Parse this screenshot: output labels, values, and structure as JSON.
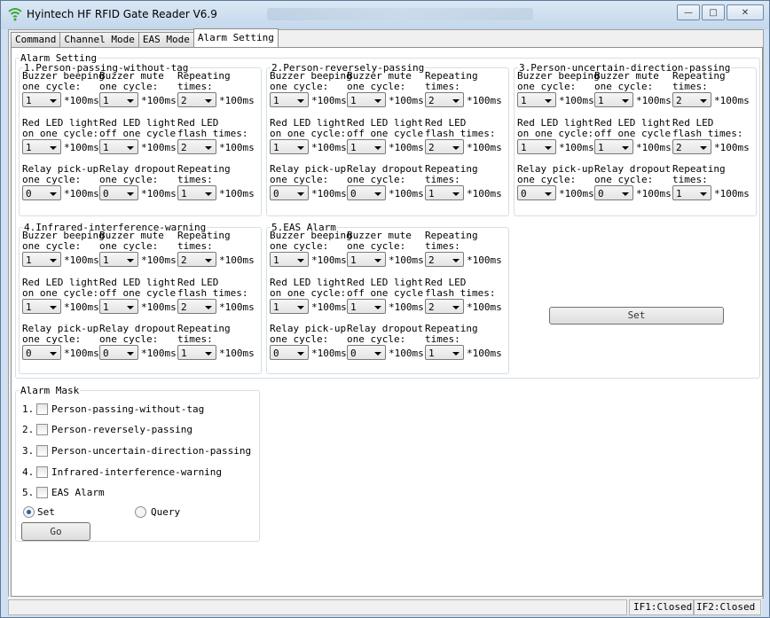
{
  "window": {
    "title": "Hyintech HF RFID Gate Reader V6.9"
  },
  "tabs": [
    "Command",
    "Channel Mode",
    "EAS Mode",
    "Alarm Setting"
  ],
  "alarm_setting": {
    "legend": "Alarm Setting",
    "unit": "*100ms",
    "labels": {
      "buzzer_beep": "Buzzer beeping\none cycle:",
      "buzzer_mute": "Buzzer mute\none cycle:",
      "repeat": "Repeating\ntimes:",
      "red_on": "Red LED light\non one cycle:",
      "red_off": "Red LED light\noff one cycle",
      "red_flash": "Red LED\nflash times:",
      "relay_pick": "Relay pick-up\none cycle:",
      "relay_drop": "Relay dropout\none cycle:",
      "relay_repeat": "Repeating\ntimes:"
    },
    "groups": [
      {
        "title": "1.Person-passing-without-tag",
        "values": [
          "1",
          "1",
          "2",
          "1",
          "1",
          "2",
          "0",
          "0",
          "1"
        ]
      },
      {
        "title": "2.Person-reversely-passing",
        "values": [
          "1",
          "1",
          "2",
          "1",
          "1",
          "2",
          "0",
          "0",
          "1"
        ]
      },
      {
        "title": "3.Person-uncertain-direction-passing",
        "values": [
          "1",
          "1",
          "2",
          "1",
          "1",
          "2",
          "0",
          "0",
          "1"
        ]
      },
      {
        "title": "4.Infrared-interference-warning",
        "values": [
          "1",
          "1",
          "2",
          "1",
          "1",
          "2",
          "0",
          "0",
          "1"
        ]
      },
      {
        "title": "5.EAS Alarm",
        "values": [
          "1",
          "1",
          "2",
          "1",
          "1",
          "2",
          "0",
          "0",
          "1"
        ]
      }
    ],
    "set_button": "Set"
  },
  "alarm_mask": {
    "legend": "Alarm Mask",
    "items": [
      {
        "num": "1.",
        "label": "Person-passing-without-tag"
      },
      {
        "num": "2.",
        "label": "Person-reversely-passing"
      },
      {
        "num": "3.",
        "label": "Person-uncertain-direction-passing"
      },
      {
        "num": "4.",
        "label": "Infrared-interference-warning"
      },
      {
        "num": "5.",
        "label": "EAS Alarm"
      }
    ],
    "radio_set": "Set",
    "radio_query": "Query",
    "go_button": "Go"
  },
  "status": {
    "if1": "IF1:Closed",
    "if2": "IF2:Closed"
  }
}
